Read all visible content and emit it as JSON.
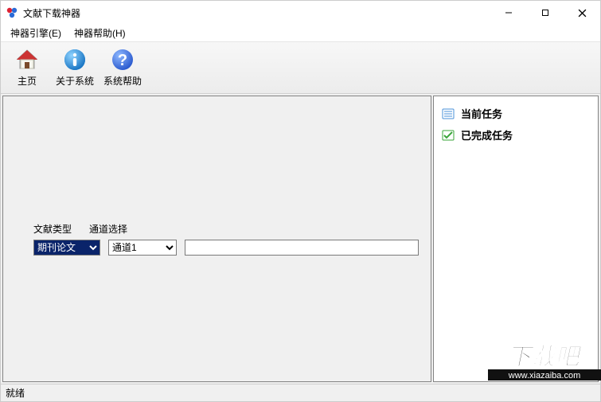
{
  "window": {
    "title": "文献下载神器"
  },
  "menubar": {
    "items": [
      "神器引擎(E)",
      "神器帮助(H)"
    ]
  },
  "toolbar": {
    "home": "主页",
    "about": "关于系统",
    "help": "系统帮助"
  },
  "main": {
    "label_doc_type": "文献类型",
    "label_channel": "通道选择",
    "doc_type_value": "期刊论文",
    "channel_value": "通道1",
    "search_value": ""
  },
  "side": {
    "current_tasks": "当前任务",
    "done_tasks": "已完成任务"
  },
  "statusbar": {
    "text": "就绪"
  },
  "watermark": {
    "brand": "下载吧",
    "url": "www.xiazaiba.com"
  }
}
